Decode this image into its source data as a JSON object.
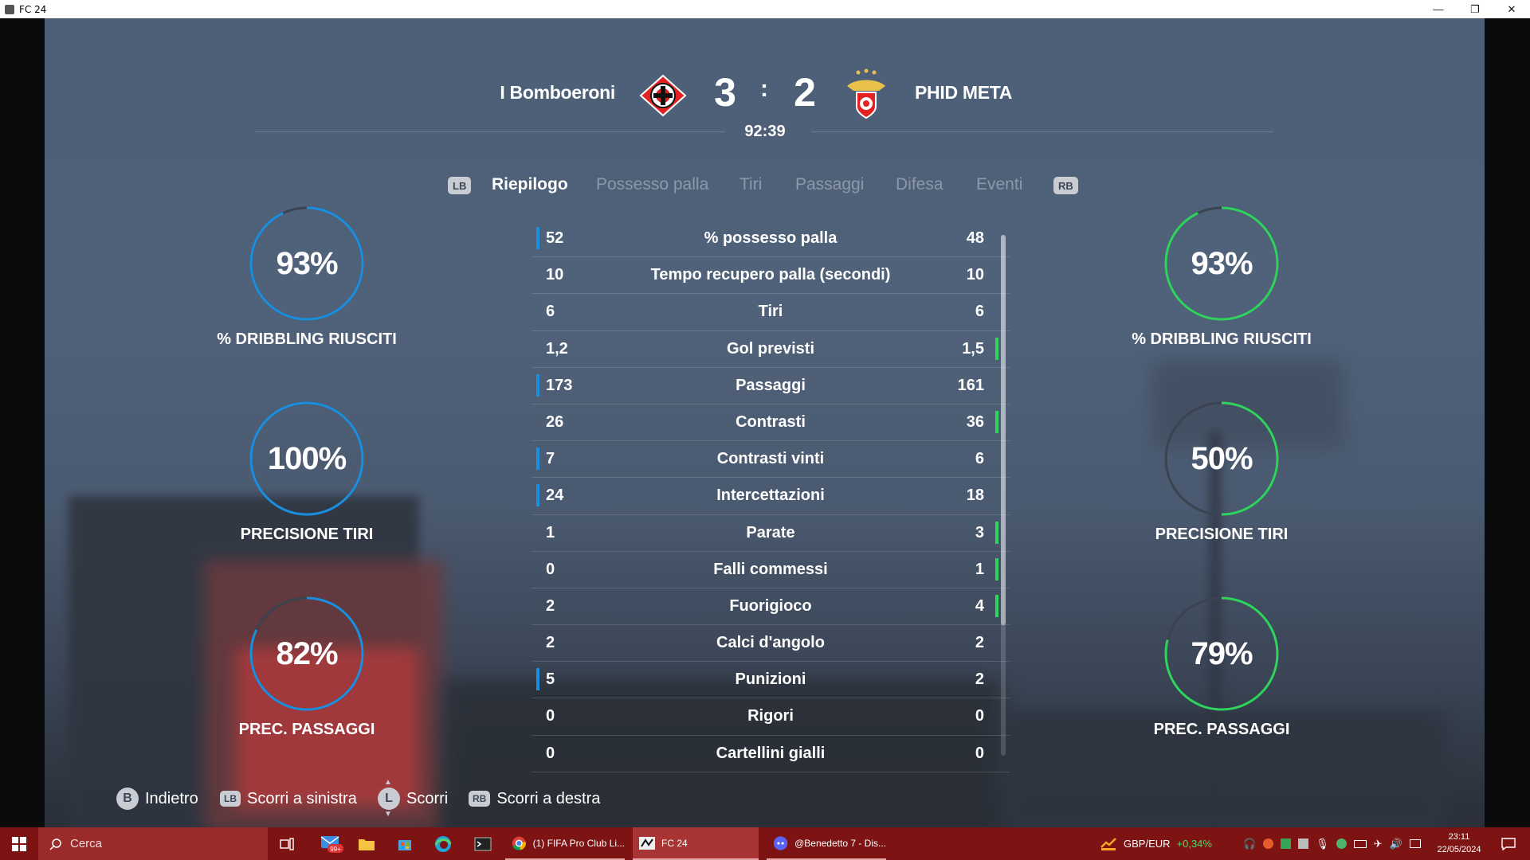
{
  "window": {
    "title": "FC 24",
    "minimize": "—",
    "restore": "❐",
    "close": "✕"
  },
  "match": {
    "home_team": "I Bomboeroni",
    "away_team": "PHID META",
    "home_score": "3",
    "separator": ":",
    "away_score": "2",
    "clock": "92:39"
  },
  "tabs": {
    "lb": "LB",
    "rb": "RB",
    "items": [
      "Riepilogo",
      "Possesso palla",
      "Tiri",
      "Passaggi",
      "Difesa",
      "Eventi"
    ],
    "active": "Riepilogo"
  },
  "home_circles": [
    {
      "value": "93%",
      "label": "% DRIBBLING RIUSCITI",
      "fraction": 0.93
    },
    {
      "value": "100%",
      "label": "PRECISIONE TIRI",
      "fraction": 1.0
    },
    {
      "value": "82%",
      "label": "PREC. PASSAGGI",
      "fraction": 0.82
    }
  ],
  "away_circles": [
    {
      "value": "93%",
      "label": "% DRIBBLING RIUSCITI",
      "fraction": 0.93
    },
    {
      "value": "50%",
      "label": "PRECISIONE TIRI",
      "fraction": 0.5
    },
    {
      "value": "79%",
      "label": "PREC. PASSAGGI",
      "fraction": 0.79
    }
  ],
  "colors": {
    "home_accent": "#1a8fe0",
    "away_accent": "#2ed45c",
    "ring_track": "#3a4350"
  },
  "stats": [
    {
      "home": "52",
      "name": "% possesso palla",
      "away": "48",
      "lead": "home"
    },
    {
      "home": "10",
      "name": "Tempo recupero palla (secondi)",
      "away": "10",
      "lead": "none"
    },
    {
      "home": "6",
      "name": "Tiri",
      "away": "6",
      "lead": "none"
    },
    {
      "home": "1,2",
      "name": "Gol previsti",
      "away": "1,5",
      "lead": "away"
    },
    {
      "home": "173",
      "name": "Passaggi",
      "away": "161",
      "lead": "home"
    },
    {
      "home": "26",
      "name": "Contrasti",
      "away": "36",
      "lead": "away"
    },
    {
      "home": "7",
      "name": "Contrasti vinti",
      "away": "6",
      "lead": "home"
    },
    {
      "home": "24",
      "name": "Intercettazioni",
      "away": "18",
      "lead": "home"
    },
    {
      "home": "1",
      "name": "Parate",
      "away": "3",
      "lead": "away"
    },
    {
      "home": "0",
      "name": "Falli commessi",
      "away": "1",
      "lead": "away"
    },
    {
      "home": "2",
      "name": "Fuorigioco",
      "away": "4",
      "lead": "away"
    },
    {
      "home": "2",
      "name": "Calci d'angolo",
      "away": "2",
      "lead": "none"
    },
    {
      "home": "5",
      "name": "Punizioni",
      "away": "2",
      "lead": "home"
    },
    {
      "home": "0",
      "name": "Rigori",
      "away": "0",
      "lead": "none"
    },
    {
      "home": "0",
      "name": "Cartellini gialli",
      "away": "0",
      "lead": "none"
    }
  ],
  "hints": [
    {
      "button": "B",
      "label": "Indietro"
    },
    {
      "button": "LB",
      "label": "Scorri a sinistra"
    },
    {
      "button": "L",
      "label": "Scorri"
    },
    {
      "button": "RB",
      "label": "Scorri a destra"
    }
  ],
  "taskbar": {
    "search_placeholder": "Cerca",
    "mail_badge": "99+",
    "apps": [
      {
        "label": "(1) FIFA Pro Club Li...",
        "icon": "chrome-icon"
      },
      {
        "label": "FC 24",
        "icon": "fc24-icon"
      },
      {
        "label": "@Benedetto 7 - Dis...",
        "icon": "discord-icon"
      }
    ],
    "currency": "GBP/EUR",
    "currency_change": "+0,34%",
    "time": "23:11",
    "date": "22/05/2024"
  }
}
